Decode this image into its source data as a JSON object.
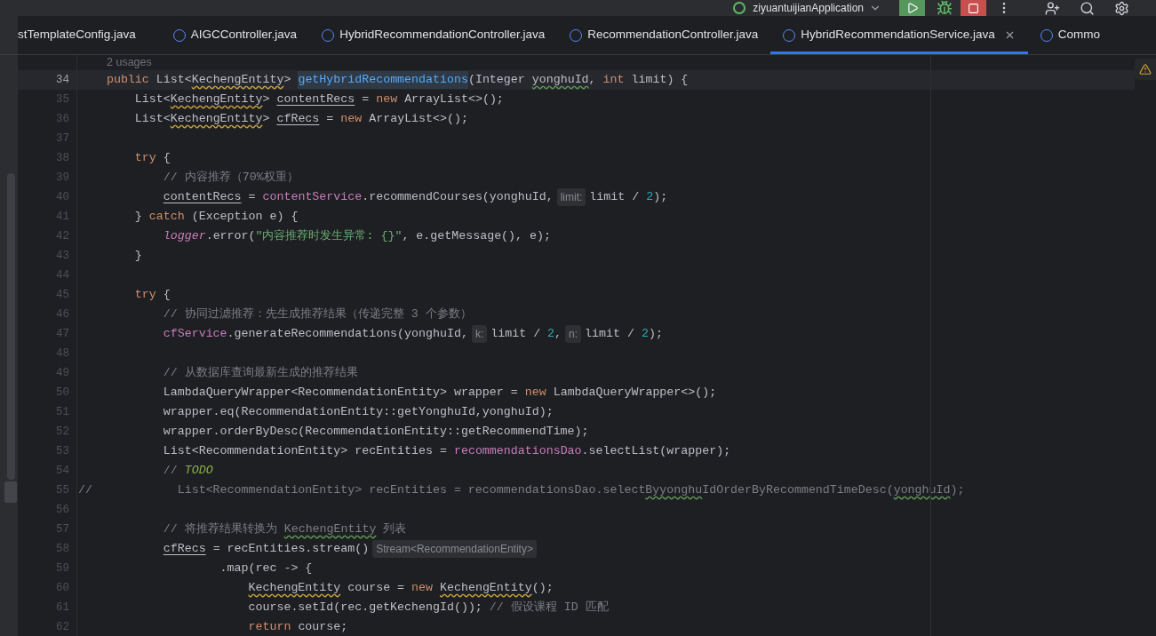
{
  "toolbar": {
    "run_config": "ziyuantuijianApplication"
  },
  "tabs": [
    {
      "label": "stTemplateConfig.java",
      "selected": false,
      "kind": "cut"
    },
    {
      "label": "AIGCController.java",
      "selected": false,
      "kind": "class"
    },
    {
      "label": "HybridRecommendationController.java",
      "selected": false,
      "kind": "class"
    },
    {
      "label": "RecommendationController.java",
      "selected": false,
      "kind": "class"
    },
    {
      "label": "HybridRecommendationService.java",
      "selected": true,
      "kind": "class"
    },
    {
      "label": "Commo",
      "selected": false,
      "kind": "class"
    }
  ],
  "editor": {
    "usages": "2 usages",
    "lines": [
      {
        "number": "34",
        "current": true,
        "tokens": [
          {
            "t": "    public",
            "kind": "kw"
          },
          {
            "t": " List<",
            "kind": "p"
          },
          {
            "t": "KechengEntity",
            "kind": "warn"
          },
          {
            "t": ">",
            "kind": "p"
          },
          {
            "t": " getHybridRecommendations",
            "kind": "decl"
          },
          {
            "t": "(Integer ",
            "kind": "p"
          },
          {
            "t": "yonghuId",
            "kind": "typo"
          },
          {
            "t": ",",
            "kind": "p"
          },
          {
            "t": " int",
            "kind": "kw"
          },
          {
            "t": " limit) {",
            "kind": "p"
          }
        ]
      },
      {
        "number": "35",
        "current": false,
        "tokens": [
          {
            "t": "        List<",
            "kind": "p"
          },
          {
            "t": "KechengEntity",
            "kind": "warn"
          },
          {
            "t": ">",
            "kind": "p"
          },
          {
            "t": " contentRecs",
            "kind": "mut"
          },
          {
            "t": " =",
            "kind": "p"
          },
          {
            "t": " new",
            "kind": "kw"
          },
          {
            "t": " ArrayList<>();",
            "kind": "p"
          }
        ]
      },
      {
        "number": "36",
        "current": false,
        "tokens": [
          {
            "t": "        List<",
            "kind": "p"
          },
          {
            "t": "KechengEntity",
            "kind": "warn"
          },
          {
            "t": ">",
            "kind": "p"
          },
          {
            "t": " cfRecs",
            "kind": "mut"
          },
          {
            "t": " =",
            "kind": "p"
          },
          {
            "t": " new",
            "kind": "kw"
          },
          {
            "t": " ArrayList<>();",
            "kind": "p"
          }
        ]
      },
      {
        "number": "37",
        "current": false
      },
      {
        "number": "38",
        "current": false,
        "tokens": [
          {
            "t": "        try",
            "kind": "kw"
          },
          {
            "t": " {",
            "kind": "p"
          }
        ]
      },
      {
        "number": "39",
        "current": false,
        "tokens": [
          {
            "t": "            // 内容推荐（70%权重）",
            "kind": "cm"
          }
        ]
      },
      {
        "number": "40",
        "current": false,
        "tokens": [
          {
            "t": "            contentRecs",
            "kind": "mut"
          },
          {
            "t": " =",
            "kind": "p"
          },
          {
            "t": " contentService",
            "kind": "field"
          },
          {
            "t": ".recommendCourses(yonghuId,",
            "kind": "p"
          },
          {
            "t": "limit:",
            "kind": "hint"
          },
          {
            "t": "limit /",
            "kind": "p"
          },
          {
            "t": " 2",
            "kind": "num"
          },
          {
            "t": ");",
            "kind": "p"
          }
        ]
      },
      {
        "number": "41",
        "current": false,
        "tokens": [
          {
            "t": "        }",
            "kind": "p"
          },
          {
            "t": " catch",
            "kind": "kw"
          },
          {
            "t": " (Exception e) {",
            "kind": "p"
          }
        ]
      },
      {
        "number": "42",
        "current": false,
        "tokens": [
          {
            "t": "            logger",
            "kind": "static"
          },
          {
            "t": ".error(",
            "kind": "p"
          },
          {
            "t": "\"内容推荐时发生异常: {}\"",
            "kind": "str"
          },
          {
            "t": ", e.getMessage(), e);",
            "kind": "p"
          }
        ]
      },
      {
        "number": "43",
        "current": false,
        "tokens": [
          {
            "t": "        }",
            "kind": "p"
          }
        ]
      },
      {
        "number": "44",
        "current": false
      },
      {
        "number": "45",
        "current": false,
        "tokens": [
          {
            "t": "        try",
            "kind": "kw"
          },
          {
            "t": " {",
            "kind": "p"
          }
        ]
      },
      {
        "number": "46",
        "current": false,
        "tokens": [
          {
            "t": "            // 协同过滤推荐：先生成推荐结果（传递完整 3 个参数）",
            "kind": "cm"
          }
        ]
      },
      {
        "number": "47",
        "current": false,
        "tokens": [
          {
            "t": "            cfService",
            "kind": "field"
          },
          {
            "t": ".generateRecommendations(yonghuId,",
            "kind": "p"
          },
          {
            "t": "k:",
            "kind": "hint"
          },
          {
            "t": "limit /",
            "kind": "p"
          },
          {
            "t": " 2",
            "kind": "num"
          },
          {
            "t": ",",
            "kind": "p"
          },
          {
            "t": "n:",
            "kind": "hint"
          },
          {
            "t": "limit /",
            "kind": "p"
          },
          {
            "t": " 2",
            "kind": "num"
          },
          {
            "t": ");",
            "kind": "p"
          }
        ]
      },
      {
        "number": "48",
        "current": false
      },
      {
        "number": "49",
        "current": false,
        "tokens": [
          {
            "t": "            // 从数据库查询最新生成的推荐结果",
            "kind": "cm"
          }
        ]
      },
      {
        "number": "50",
        "current": false,
        "tokens": [
          {
            "t": "            LambdaQueryWrapper<RecommendationEntity> wrapper =",
            "kind": "p"
          },
          {
            "t": " new",
            "kind": "kw"
          },
          {
            "t": " LambdaQueryWrapper<>();",
            "kind": "p"
          }
        ]
      },
      {
        "number": "51",
        "current": false,
        "tokens": [
          {
            "t": "            wrapper.eq(RecommendationEntity::getYonghuId,yonghuId);",
            "kind": "p"
          }
        ]
      },
      {
        "number": "52",
        "current": false,
        "tokens": [
          {
            "t": "            wrapper.orderByDesc(RecommendationEntity::getRecommendTime);",
            "kind": "p"
          }
        ]
      },
      {
        "number": "53",
        "current": false,
        "tokens": [
          {
            "t": "            List<RecommendationEntity> recEntities =",
            "kind": "p"
          },
          {
            "t": " recommendationsDao",
            "kind": "field"
          },
          {
            "t": ".selectList(wrapper);",
            "kind": "p"
          }
        ]
      },
      {
        "number": "54",
        "current": false,
        "tokens": [
          {
            "t": "            //",
            "kind": "cm"
          },
          {
            "t": " TODO",
            "kind": "todo"
          }
        ]
      },
      {
        "number": "55",
        "current": false,
        "tokens": [
          {
            "t": "//            List<RecommendationEntity> recEntities = recommendationsDao.select",
            "kind": "cm"
          },
          {
            "t": "Byyonghu",
            "kind": "cmtypo"
          },
          {
            "t": "IdOrderByRecommendTimeDesc(",
            "kind": "cm"
          },
          {
            "t": "yonghuId",
            "kind": "cmtypo"
          },
          {
            "t": ");",
            "kind": "cm"
          }
        ]
      },
      {
        "number": "56",
        "current": false
      },
      {
        "number": "57",
        "current": false,
        "tokens": [
          {
            "t": "            // 将推荐结果转换为",
            "kind": "cm"
          },
          {
            "t": " KechengEntity",
            "kind": "cmtypo"
          },
          {
            "t": " 列表",
            "kind": "cm"
          }
        ]
      },
      {
        "number": "58",
        "current": false,
        "tokens": [
          {
            "t": "            cfRecs",
            "kind": "mut"
          },
          {
            "t": " = recEntities.stream()",
            "kind": "p"
          },
          {
            "t": "Stream<RecommendationEntity>",
            "kind": "hint"
          }
        ]
      },
      {
        "number": "59",
        "current": false,
        "tokens": [
          {
            "t": "                    .map(rec -> {",
            "kind": "p"
          }
        ]
      },
      {
        "number": "60",
        "current": false,
        "tokens": [
          {
            "t": "                        KechengEntity",
            "kind": "warn"
          },
          {
            "t": " course =",
            "kind": "p"
          },
          {
            "t": " new",
            "kind": "kw"
          },
          {
            "t": " KechengEntity",
            "kind": "warn"
          },
          {
            "t": "();",
            "kind": "p"
          }
        ]
      },
      {
        "number": "61",
        "current": false,
        "tokens": [
          {
            "t": "                        course.setId(rec.getKechengId());",
            "kind": "p"
          },
          {
            "t": " // 假设课程 ID 匹配",
            "kind": "cm"
          }
        ]
      },
      {
        "number": "62",
        "current": false,
        "tokens": [
          {
            "t": "                        return",
            "kind": "kw"
          },
          {
            "t": " course;",
            "kind": "p"
          }
        ]
      }
    ]
  }
}
